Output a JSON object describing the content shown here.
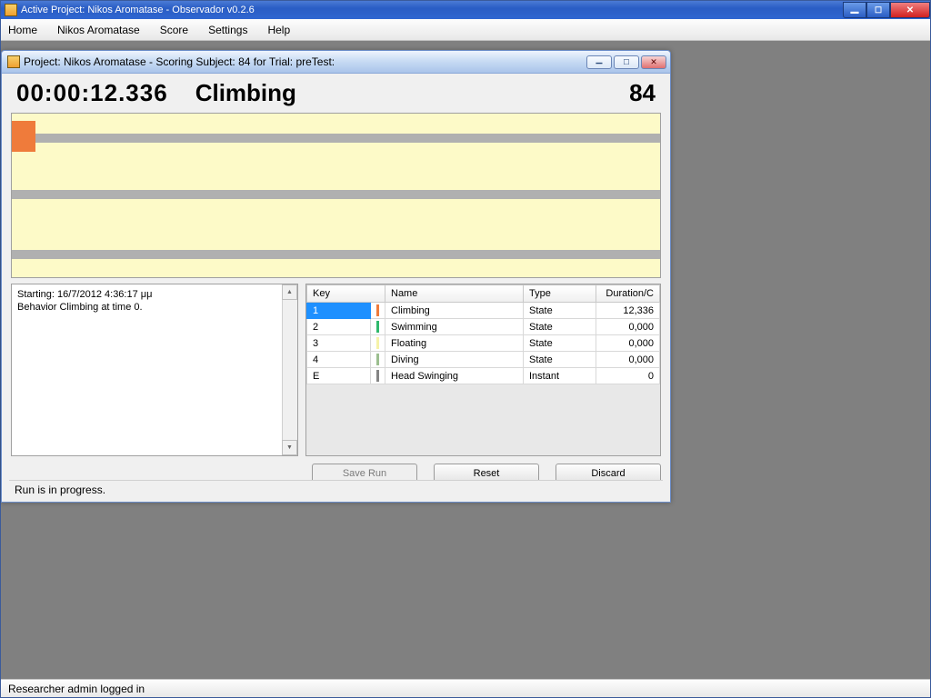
{
  "main_window": {
    "title": "Active Project: Nikos Aromatase - Observador v0.2.6"
  },
  "menubar": {
    "items": [
      "Home",
      "Nikos Aromatase",
      "Score",
      "Settings",
      "Help"
    ]
  },
  "child_window": {
    "title": "Project: Nikos Aromatase - Scoring Subject: 84 for Trial: preTest:"
  },
  "readout": {
    "time": "00:00:12.336",
    "current_behavior": "Climbing",
    "subject": "84"
  },
  "log": {
    "line1": "Starting: 16/7/2012 4:36:17 μμ",
    "line2": "Behavior Climbing at time 0."
  },
  "behavior_table": {
    "headers": {
      "key": "Key",
      "name": "Name",
      "type": "Type",
      "duration": "Duration/C"
    },
    "rows": [
      {
        "key": "1",
        "color": "#ef7b3b",
        "name": "Climbing",
        "type": "State",
        "duration": "12,336",
        "selected": true
      },
      {
        "key": "2",
        "color": "#2fb86b",
        "name": "Swimming",
        "type": "State",
        "duration": "0,000"
      },
      {
        "key": "3",
        "color": "#f6f2a8",
        "name": "Floating",
        "type": "State",
        "duration": "0,000"
      },
      {
        "key": "4",
        "color": "#9cbf8f",
        "name": "Diving",
        "type": "State",
        "duration": "0,000"
      },
      {
        "key": "E",
        "color": "#848484",
        "name": "Head Swinging",
        "type": "Instant",
        "duration": "0"
      }
    ]
  },
  "buttons": {
    "save": "Save Run",
    "reset": "Reset",
    "discard": "Discard"
  },
  "child_status": "Run is in progress.",
  "main_status": "Researcher admin logged in"
}
